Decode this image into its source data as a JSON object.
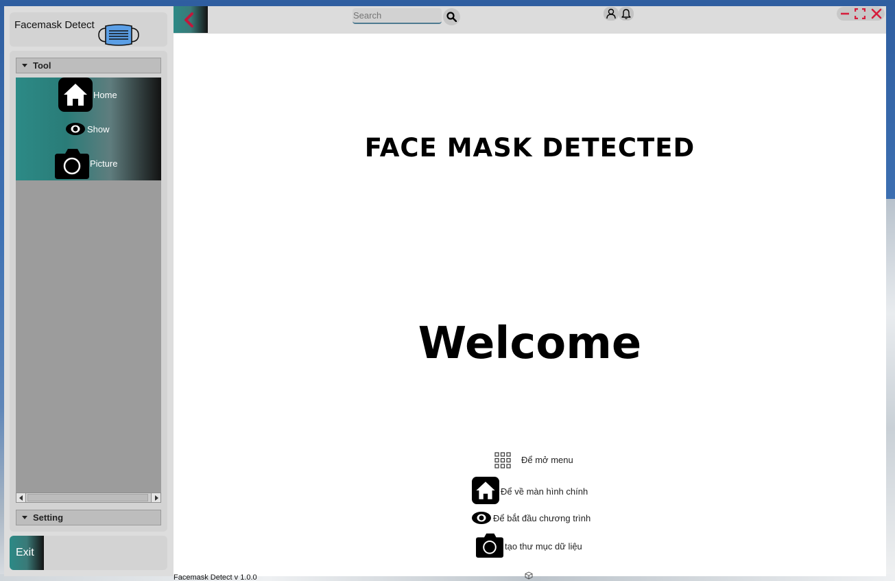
{
  "brand": {
    "title": "Facemask Detect"
  },
  "sidebar": {
    "tool_section": "Tool",
    "items": [
      {
        "label": "Home",
        "icon": "home-icon"
      },
      {
        "label": "Show",
        "icon": "eye-icon"
      },
      {
        "label": "Picture",
        "icon": "camera-icon"
      }
    ],
    "setting_section": "Setting",
    "exit_label": "Exit"
  },
  "topbar": {
    "search_placeholder": "Search",
    "icons": [
      "back-arrow-icon",
      "search-icon",
      "user-icon",
      "bell-icon",
      "minimize-icon",
      "maximize-icon",
      "close-icon"
    ]
  },
  "main": {
    "hero_title": "FACE MASK DETECTED",
    "welcome": "Welcome",
    "legend": [
      {
        "icon": "grid-menu-icon",
        "text": "Để mở menu"
      },
      {
        "icon": "home-icon",
        "text": "Để về màn hình chính"
      },
      {
        "icon": "eye-icon",
        "text": "Để bắt đầu chương trình"
      },
      {
        "icon": "camera-icon",
        "text": "tạo thư mục dữ liệu"
      }
    ]
  },
  "footer": {
    "version": "Facemask Detect v 1.0.0"
  },
  "colors": {
    "accent_teal": "#2c8a86",
    "back_arrow": "#c0183c",
    "window_controls": "#d61d3c",
    "panel_bg": "#d3d3d3",
    "tool_area_bg": "#9c9c9c"
  }
}
